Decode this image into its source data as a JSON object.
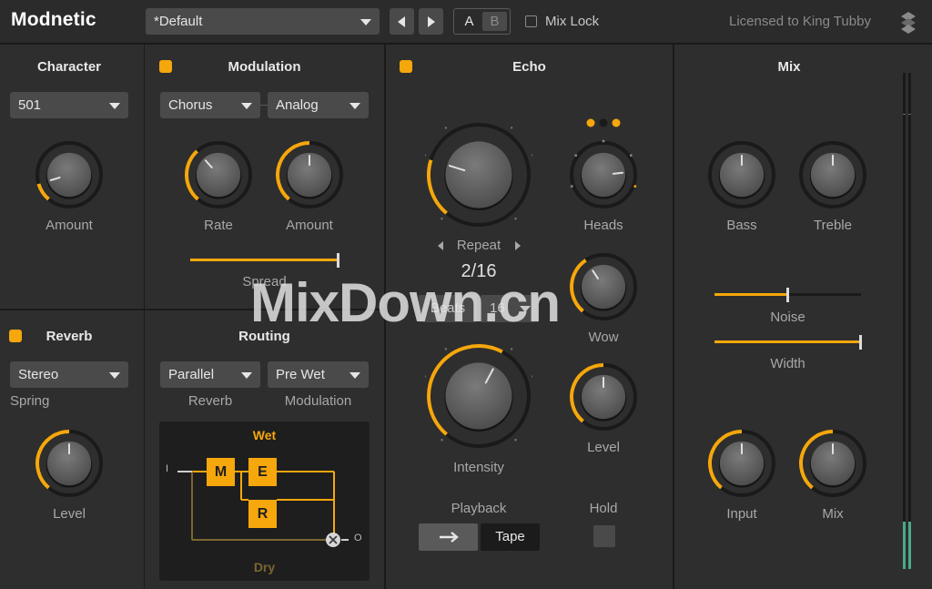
{
  "app": {
    "title": "Modnetic",
    "license_text": "Licensed to King Tubby"
  },
  "toolbar": {
    "preset": "*Default",
    "prev_icon": "triangle-left-icon",
    "next_icon": "triangle-right-icon",
    "ab_a": "A",
    "ab_b": "B",
    "ab_selected": "A",
    "mix_lock_label": "Mix Lock",
    "mix_lock_checked": false
  },
  "colors": {
    "accent": "#f5a70c",
    "panel": "#2e2e2e",
    "background": "#1b1b1b",
    "meter": "#4aaa8c"
  },
  "character": {
    "title": "Character",
    "model": "501",
    "knob_label": "Amount",
    "knob_value": 0.12
  },
  "modulation": {
    "title": "Modulation",
    "enabled": true,
    "type": "Chorus",
    "mode": "Analog",
    "rate_label": "Rate",
    "rate_value": 0.35,
    "amount_label": "Amount",
    "amount_value": 0.5,
    "spread_label": "Spread",
    "spread_value": 1.0
  },
  "reverb": {
    "title": "Reverb",
    "enabled": true,
    "type": "Stereo",
    "type_sub": "Spring",
    "level_label": "Level",
    "level_value": 0.5
  },
  "routing": {
    "title": "Routing",
    "reverb_mode": "Parallel",
    "reverb_label": "Reverb",
    "mod_mode": "Pre Wet",
    "mod_label": "Modulation",
    "wet_label": "Wet",
    "dry_label": "Dry",
    "in_label": "I",
    "out_label": "O",
    "block_m": "M",
    "block_e": "E",
    "block_r": "R"
  },
  "echo": {
    "title": "Echo",
    "enabled": true,
    "repeat_label": "Repeat",
    "repeat_value_text": "2/16",
    "repeat_knob_value": 0.24,
    "sync_mode": "Beats",
    "sync_value": "16",
    "heads_label": "Heads",
    "heads_value": 0.8,
    "wow_label": "Wow",
    "wow_value": 0.38,
    "intensity_label": "Intensity",
    "intensity_value": 0.6,
    "level_label": "Level",
    "level_value": 0.5,
    "playback_label": "Playback",
    "playback_direction_icon": "arrow-right-icon",
    "playback_mode": "Tape",
    "hold_label": "Hold",
    "hold_on": false
  },
  "mix": {
    "title": "Mix",
    "bass_label": "Bass",
    "bass_value": 0.5,
    "treble_label": "Treble",
    "treble_value": 0.5,
    "noise_label": "Noise",
    "noise_value": 0.5,
    "width_label": "Width",
    "width_value": 1.0,
    "input_label": "Input",
    "input_value": 0.5,
    "mix_label": "Mix",
    "mix_value": 0.5
  },
  "watermark": "MixDown.cn"
}
